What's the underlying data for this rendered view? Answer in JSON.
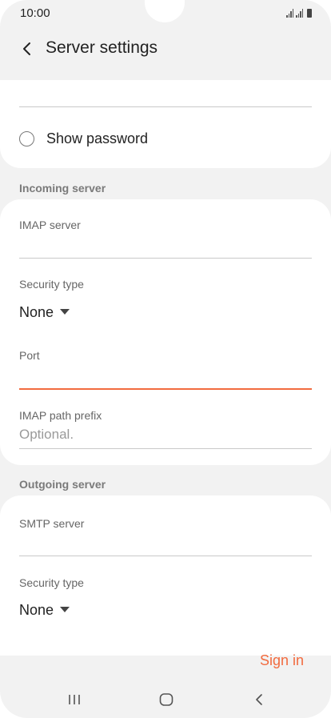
{
  "status_bar": {
    "time": "10:00"
  },
  "header": {
    "title": "Server settings"
  },
  "account": {
    "show_password_label": "Show password"
  },
  "incoming": {
    "header": "Incoming server",
    "imap_server_label": "IMAP server",
    "imap_server_value": "",
    "security_type_label": "Security type",
    "security_type_value": "None",
    "port_label": "Port",
    "port_value": "",
    "path_prefix_label": "IMAP path prefix",
    "path_prefix_placeholder": "Optional."
  },
  "outgoing": {
    "header": "Outgoing server",
    "smtp_server_label": "SMTP server",
    "smtp_server_value": "",
    "security_type_label": "Security type",
    "security_type_value": "None"
  },
  "actions": {
    "sign_in_label": "Sign in"
  },
  "colors": {
    "accent": "#f26b3f",
    "background": "#f2f2f2",
    "card": "#ffffff"
  },
  "icons": {
    "back": "back-arrow-icon",
    "recent_apps": "recent-apps-icon",
    "home": "home-icon",
    "nav_back": "nav-back-icon"
  }
}
